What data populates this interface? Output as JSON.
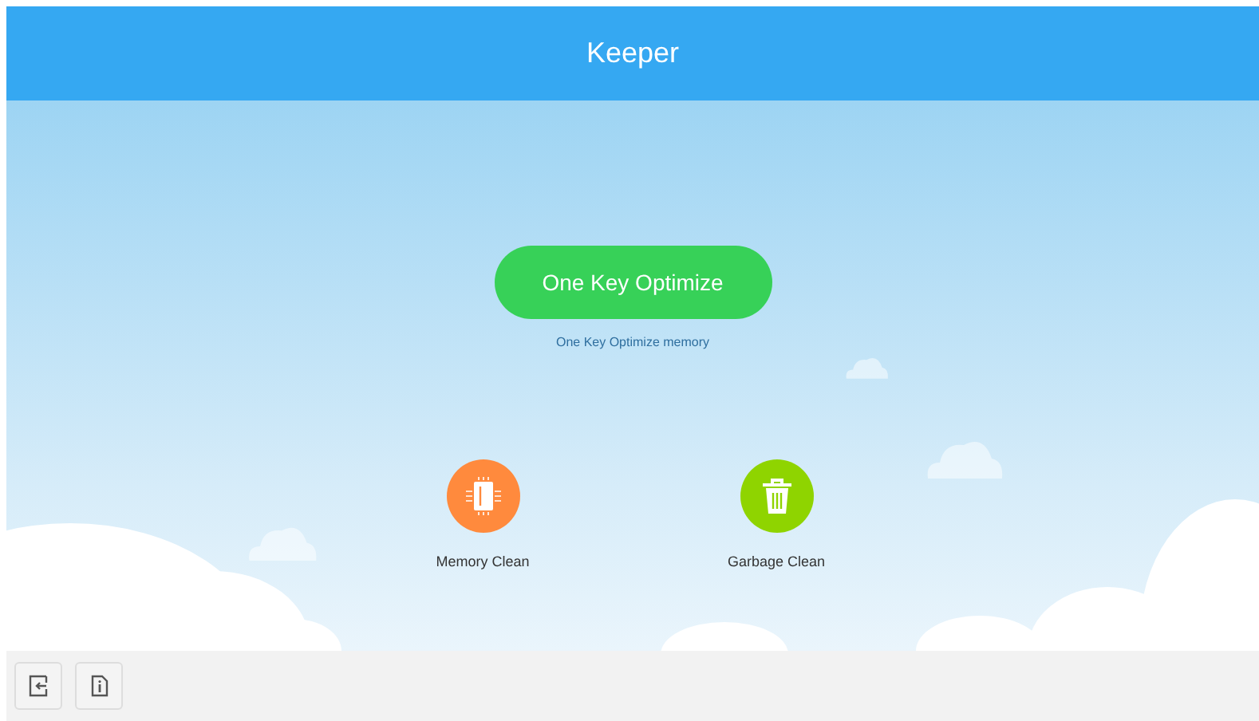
{
  "header": {
    "title": "Keeper"
  },
  "optimize": {
    "label": "One Key Optimize",
    "caption": "One Key Optimize memory"
  },
  "tools": [
    {
      "kind": "memory",
      "label": "Memory Clean",
      "color": "#ff8a3d"
    },
    {
      "kind": "garbage",
      "label": "Garbage Clean",
      "color": "#8fd400"
    }
  ],
  "footer_buttons": [
    {
      "kind": "exit"
    },
    {
      "kind": "info"
    }
  ]
}
